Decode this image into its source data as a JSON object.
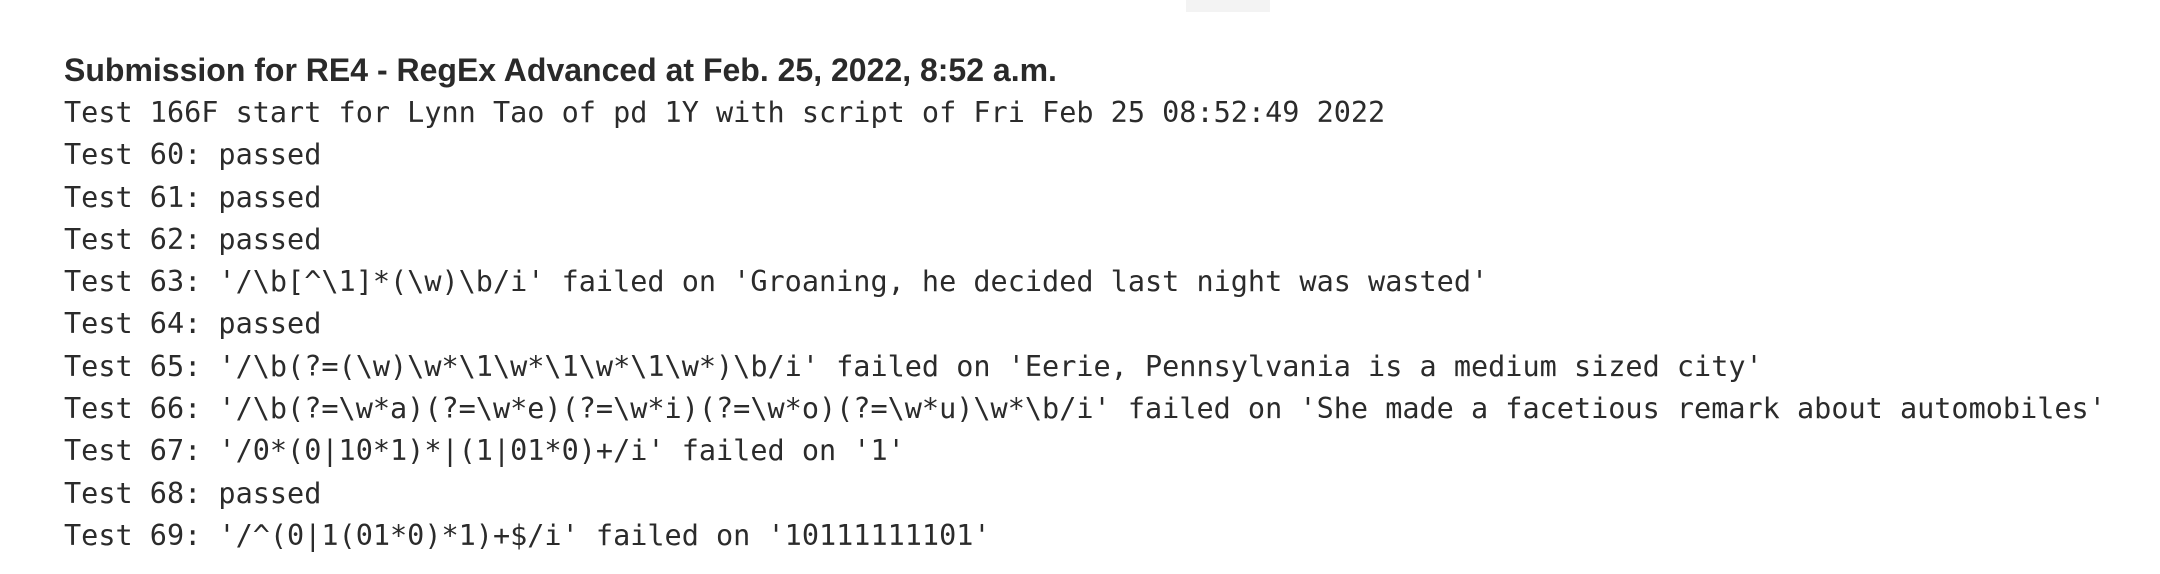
{
  "submission": {
    "title": "Submission for RE4 - RegEx Advanced at Feb. 25, 2022, 8:52 a.m."
  },
  "log": [
    "Test 166F start for Lynn Tao of pd 1Y with script of Fri Feb 25 08:52:49 2022",
    "Test 60: passed",
    "Test 61: passed",
    "Test 62: passed",
    "Test 63: '/\\b[^\\1]*(\\w)\\b/i' failed on 'Groaning, he decided last night was wasted'",
    "Test 64: passed",
    "Test 65: '/\\b(?=(\\w)\\w*\\1\\w*\\1\\w*\\1\\w*)\\b/i' failed on 'Eerie, Pennsylvania is a medium sized city'",
    "Test 66: '/\\b(?=\\w*a)(?=\\w*e)(?=\\w*i)(?=\\w*o)(?=\\w*u)\\w*\\b/i' failed on 'She made a facetious remark about automobiles'",
    "Test 67: '/0*(0|10*1)*|(1|01*0)+/i' failed on '1'",
    "Test 68: passed",
    "Test 69: '/^(0|1(01*0)*1)+$/i' failed on '10111111101'"
  ]
}
